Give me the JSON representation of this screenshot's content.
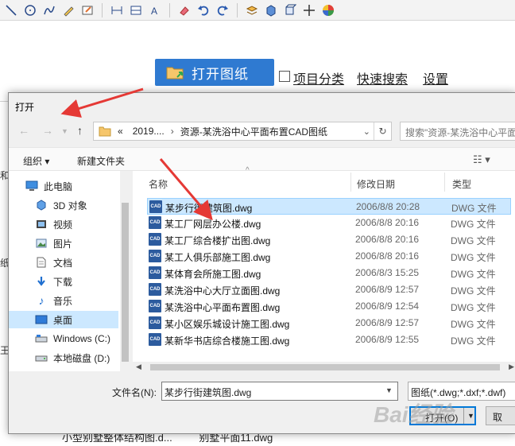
{
  "app": {
    "open_drawing_label": "打开图纸",
    "project_category_label": "项目分类",
    "quick_search_label": "快速搜索",
    "settings_label": "设置",
    "left_fragments": [
      "和",
      "纸",
      "王"
    ],
    "background_files": [
      "小型别墅整体结构图.d...",
      "别墅平面11.dwg"
    ]
  },
  "toolbar_icons": [
    "line-icon",
    "circle-icon",
    "curve-icon",
    "pencil-icon",
    "eraser-doc-icon",
    "dimension-icon",
    "table-icon",
    "text-icon",
    "eraser-icon",
    "undo-icon",
    "redo-icon",
    "layers-icon",
    "box-3d-icon",
    "cube-icon",
    "move-icon",
    "color-wheel-icon"
  ],
  "dialog": {
    "title": "打开",
    "address_prefix": "«",
    "address_parts": [
      "2019....",
      "资源-某洗浴中心平面布置CAD图纸"
    ],
    "search_placeholder": "搜索\"资源-某洗浴中心平面...",
    "organize_label": "组织 ▾",
    "new_folder_label": "新建文件夹",
    "nav_items": [
      {
        "label": "此电脑",
        "icon": "computer-icon"
      },
      {
        "label": "3D 对象",
        "icon": "cube-3d-icon"
      },
      {
        "label": "视频",
        "icon": "video-icon"
      },
      {
        "label": "图片",
        "icon": "picture-icon"
      },
      {
        "label": "文档",
        "icon": "document-icon"
      },
      {
        "label": "下载",
        "icon": "download-icon"
      },
      {
        "label": "音乐",
        "icon": "music-icon"
      },
      {
        "label": "桌面",
        "icon": "desktop-icon",
        "selected": true
      },
      {
        "label": "Windows (C:)",
        "icon": "drive-c-icon"
      },
      {
        "label": "本地磁盘 (D:)",
        "icon": "drive-d-icon"
      }
    ],
    "columns": {
      "name": "名称",
      "date": "修改日期",
      "type": "类型"
    },
    "files": [
      {
        "name": "某步行街建筑图.dwg",
        "date": "2006/8/8 20:28",
        "type": "DWG 文件",
        "selected": true
      },
      {
        "name": "某工厂网层办公楼.dwg",
        "date": "2006/8/8 20:16",
        "type": "DWG 文件"
      },
      {
        "name": "某工厂综合楼扩出图.dwg",
        "date": "2006/8/8 20:16",
        "type": "DWG 文件"
      },
      {
        "name": "某工人俱乐部施工图.dwg",
        "date": "2006/8/8 20:16",
        "type": "DWG 文件"
      },
      {
        "name": "某体育会所施工图.dwg",
        "date": "2006/8/3 15:25",
        "type": "DWG 文件"
      },
      {
        "name": "某洗浴中心大厅立面图.dwg",
        "date": "2006/8/9 12:57",
        "type": "DWG 文件"
      },
      {
        "name": "某洗浴中心平面布置图.dwg",
        "date": "2006/8/9 12:54",
        "type": "DWG 文件"
      },
      {
        "name": "某小区娱乐城设计施工图.dwg",
        "date": "2006/8/9 12:57",
        "type": "DWG 文件"
      },
      {
        "name": "某新华书店综合楼施工图.dwg",
        "date": "2006/8/9 12:55",
        "type": "DWG 文件"
      }
    ],
    "file_icon_text": "CAD",
    "filename_label": "文件名(N):",
    "filename_value": "某步行街建筑图.dwg",
    "filter_value": "图纸(*.dwg;*.dxf;*.dwf)",
    "open_button_label": "打开(O)",
    "cancel_button_label": "取"
  },
  "watermark": "Bai经验",
  "colors": {
    "accent": "#2f7ad1",
    "selection": "#cce8ff",
    "arrow": "#e53935",
    "cad_icon": "#2c5b9e"
  }
}
